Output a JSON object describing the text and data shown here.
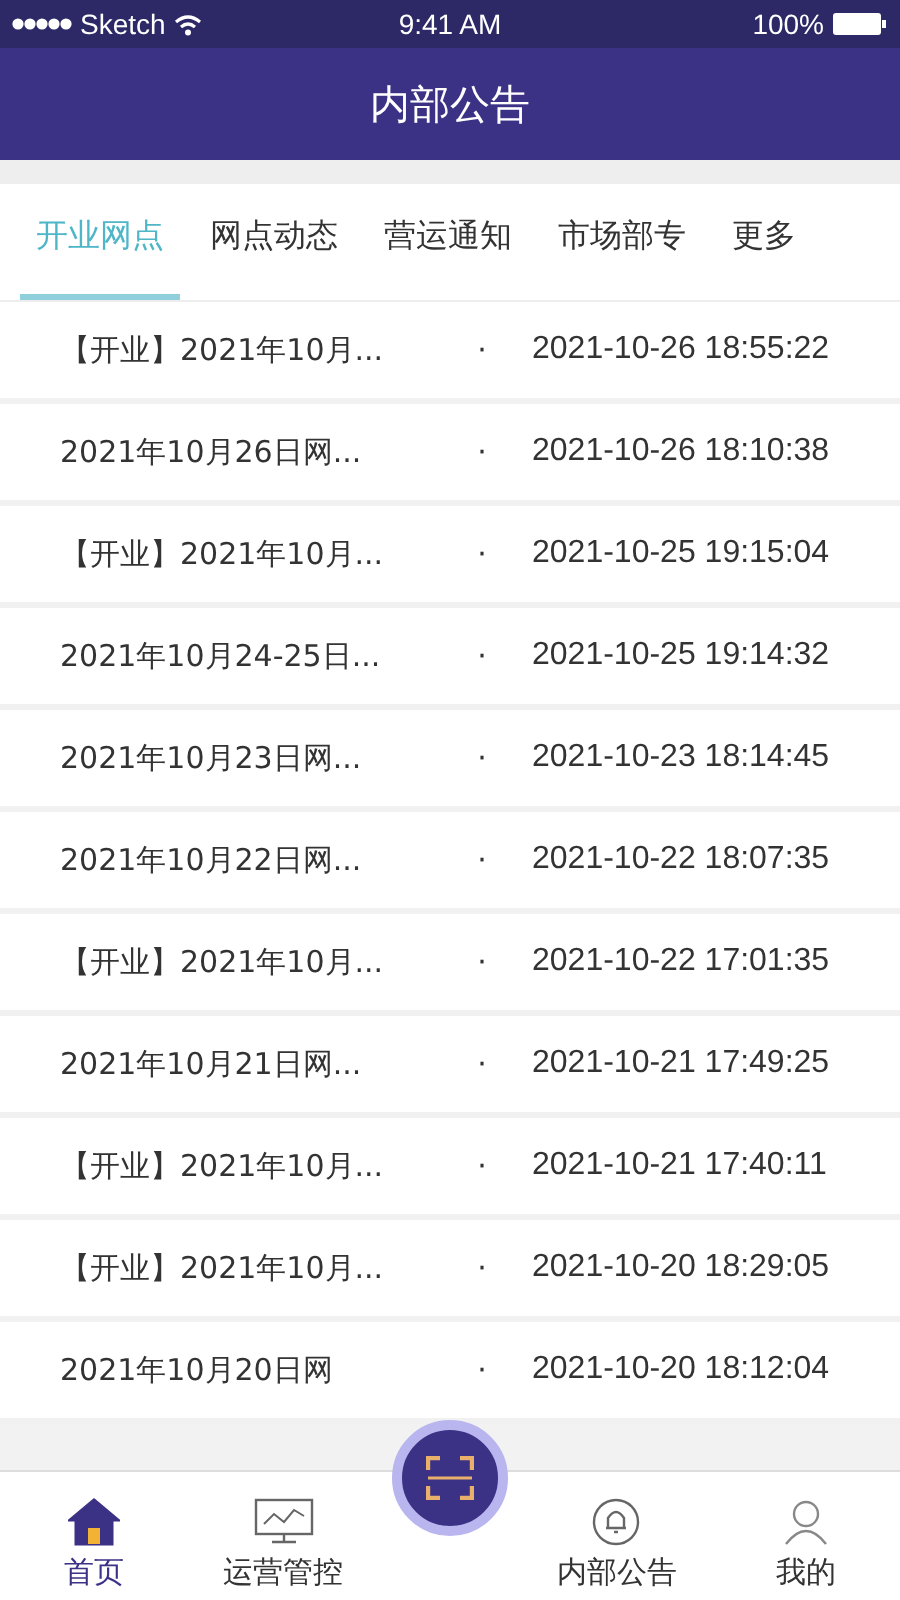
{
  "status_bar": {
    "carrier": "Sketch",
    "time": "9:41 AM",
    "battery": "100%"
  },
  "header": {
    "title": "内部公告"
  },
  "tabs": [
    {
      "label": "开业网点",
      "selected": true
    },
    {
      "label": "网点动态",
      "selected": false
    },
    {
      "label": "营运通知",
      "selected": false
    },
    {
      "label": "市场部专",
      "selected": false
    },
    {
      "label": "更多",
      "selected": false
    }
  ],
  "rows": [
    {
      "title": "【开业】2021年10月...",
      "dot": "·",
      "time": "2021-10-26 18:55:22"
    },
    {
      "title": "2021年10月26日网...",
      "dot": "·",
      "time": "2021-10-26 18:10:38"
    },
    {
      "title": "【开业】2021年10月...",
      "dot": "·",
      "time": "2021-10-25 19:15:04"
    },
    {
      "title": "2021年10月24-25日...",
      "dot": "·",
      "time": "2021-10-25 19:14:32"
    },
    {
      "title": "2021年10月23日网...",
      "dot": "·",
      "time": "2021-10-23 18:14:45"
    },
    {
      "title": "2021年10月22日网...",
      "dot": "·",
      "time": "2021-10-22 18:07:35"
    },
    {
      "title": "【开业】2021年10月...",
      "dot": "·",
      "time": "2021-10-22 17:01:35"
    },
    {
      "title": "2021年10月21日网...",
      "dot": "·",
      "time": "2021-10-21 17:49:25"
    },
    {
      "title": "【开业】2021年10月...",
      "dot": "·",
      "time": "2021-10-21 17:40:11"
    },
    {
      "title": "【开业】2021年10月...",
      "dot": "·",
      "time": "2021-10-20 18:29:05"
    },
    {
      "title": "2021年10月20日网",
      "dot": "·",
      "time": "2021-10-20 18:12:04"
    }
  ],
  "nav": [
    {
      "kind": "home",
      "label": "首页",
      "selected": true
    },
    {
      "kind": "monitor",
      "label": "运营管控",
      "selected": false
    },
    {
      "kind": "scan",
      "selected": false
    },
    {
      "kind": "bell",
      "label": "内部公告",
      "selected": false
    },
    {
      "kind": "user",
      "label": "我的",
      "selected": false
    }
  ]
}
